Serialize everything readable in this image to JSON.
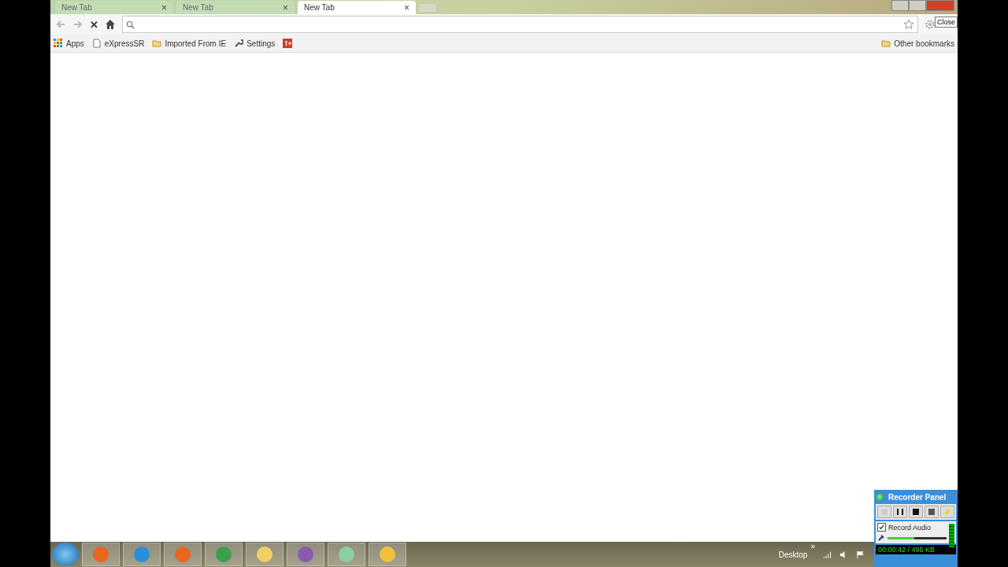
{
  "tabs": [
    {
      "label": "New Tab",
      "close": "×",
      "selected": false
    },
    {
      "label": "New Tab",
      "close": "×",
      "selected": false
    },
    {
      "label": "New Tab",
      "close": "×",
      "selected": true
    }
  ],
  "tooltip": "Close",
  "toolbar": {
    "stop": "✕"
  },
  "bookmarks": [
    {
      "kind": "apps",
      "label": "Apps"
    },
    {
      "kind": "page",
      "label": "eXpressSR"
    },
    {
      "kind": "folder",
      "label": "Imported From IE"
    },
    {
      "kind": "wrench",
      "label": "Settings"
    },
    {
      "kind": "gplus"
    }
  ],
  "other_bookmarks": "Other bookmarks",
  "taskbar": {
    "desktop": "Desktop",
    "chevron": "»"
  },
  "recorder": {
    "title": "Recorder Panel",
    "record_audio": {
      "label": "Record Audio",
      "checked": true
    },
    "volume": {
      "level": 0.45
    },
    "status": "00:00:42 / 495 KB"
  }
}
